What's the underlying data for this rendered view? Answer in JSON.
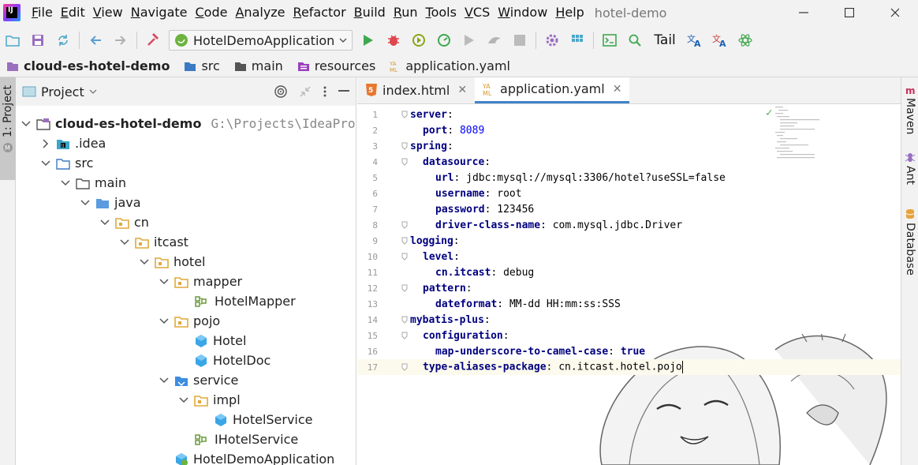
{
  "menubar": {
    "items": [
      "File",
      "Edit",
      "View",
      "Navigate",
      "Code",
      "Analyze",
      "Refactor",
      "Build",
      "Run",
      "Tools",
      "VCS",
      "Window",
      "Help"
    ],
    "project_title": "hotel-demo"
  },
  "toolbar": {
    "run_config": "HotelDemoApplication",
    "tail_label": "Tail"
  },
  "breadcrumb": {
    "items": [
      {
        "label": "cloud-es-hotel-demo",
        "bold": true
      },
      {
        "label": "src",
        "bold": false
      },
      {
        "label": "main",
        "bold": false
      },
      {
        "label": "resources",
        "bold": false
      },
      {
        "label": "application.yaml",
        "bold": false
      }
    ]
  },
  "left_toolwindow": {
    "project_tab": "1: Project"
  },
  "project_panel": {
    "title": "Project",
    "tree": [
      {
        "label": "cloud-es-hotel-demo",
        "path": "G:\\Projects\\IdeaProjec",
        "bold": true,
        "expanded": true,
        "icon": "module-folder-icon"
      },
      {
        "label": ".idea",
        "expanded": false,
        "icon": "idea-folder-icon"
      },
      {
        "label": "src",
        "expanded": true,
        "icon": "source-folder-icon"
      },
      {
        "label": "main",
        "expanded": true,
        "icon": "folder-icon"
      },
      {
        "label": "java",
        "expanded": true,
        "icon": "java-source-folder-icon"
      },
      {
        "label": "cn",
        "expanded": true,
        "icon": "package-icon"
      },
      {
        "label": "itcast",
        "expanded": true,
        "icon": "package-icon"
      },
      {
        "label": "hotel",
        "expanded": true,
        "icon": "package-icon"
      },
      {
        "label": "mapper",
        "expanded": true,
        "icon": "package-icon"
      },
      {
        "label": "HotelMapper",
        "icon": "mapper-interface-icon"
      },
      {
        "label": "pojo",
        "expanded": true,
        "icon": "package-icon"
      },
      {
        "label": "Hotel",
        "icon": "class-icon"
      },
      {
        "label": "HotelDoc",
        "icon": "class-icon"
      },
      {
        "label": "service",
        "expanded": true,
        "icon": "service-package-icon"
      },
      {
        "label": "impl",
        "expanded": true,
        "icon": "package-icon"
      },
      {
        "label": "HotelService",
        "icon": "class-icon"
      },
      {
        "label": "IHotelService",
        "icon": "interface-icon"
      },
      {
        "label": "HotelDemoApplication",
        "icon": "spring-boot-class-icon"
      }
    ]
  },
  "editor": {
    "tabs": [
      {
        "label": "index.html",
        "active": false
      },
      {
        "label": "application.yaml",
        "active": true
      }
    ],
    "lines": [
      {
        "n": "1",
        "key": "server",
        "sep": ":",
        "val": "",
        "type": ""
      },
      {
        "n": "2",
        "key": "port",
        "sep": ": ",
        "val": "8089",
        "type": "num"
      },
      {
        "n": "3",
        "key": "spring",
        "sep": ":",
        "val": "",
        "type": ""
      },
      {
        "n": "4",
        "key": "datasource",
        "sep": ":",
        "val": "",
        "type": ""
      },
      {
        "n": "5",
        "key": "url",
        "sep": ": ",
        "val": "jdbc:mysql://mysql:3306/hotel?useSSL=false",
        "type": "str"
      },
      {
        "n": "6",
        "key": "username",
        "sep": ": ",
        "val": "root",
        "type": "str"
      },
      {
        "n": "7",
        "key": "password",
        "sep": ": ",
        "val": "123456",
        "type": "str"
      },
      {
        "n": "8",
        "key": "driver-class-name",
        "sep": ": ",
        "val": "com.mysql.jdbc.Driver",
        "type": "str"
      },
      {
        "n": "9",
        "key": "logging",
        "sep": ":",
        "val": "",
        "type": ""
      },
      {
        "n": "10",
        "key": "level",
        "sep": ":",
        "val": "",
        "type": ""
      },
      {
        "n": "11",
        "key": "cn.itcast",
        "sep": ": ",
        "val": "debug",
        "type": "str"
      },
      {
        "n": "12",
        "key": "pattern",
        "sep": ":",
        "val": "",
        "type": ""
      },
      {
        "n": "13",
        "key": "dateformat",
        "sep": ": ",
        "val": "MM-dd HH:mm:ss:SSS",
        "type": "str"
      },
      {
        "n": "14",
        "key": "mybatis-plus",
        "sep": ":",
        "val": "",
        "type": ""
      },
      {
        "n": "15",
        "key": "configuration",
        "sep": ":",
        "val": "",
        "type": ""
      },
      {
        "n": "16",
        "key": "map-underscore-to-camel-case",
        "sep": ": ",
        "val": "true",
        "type": "bool"
      },
      {
        "n": "17",
        "key": "type-aliases-package",
        "sep": ": ",
        "val": "cn.itcast.hotel.pojo",
        "type": "str"
      }
    ]
  },
  "right_toolwindow": {
    "tabs": [
      "Maven",
      "Ant",
      "Database"
    ]
  }
}
